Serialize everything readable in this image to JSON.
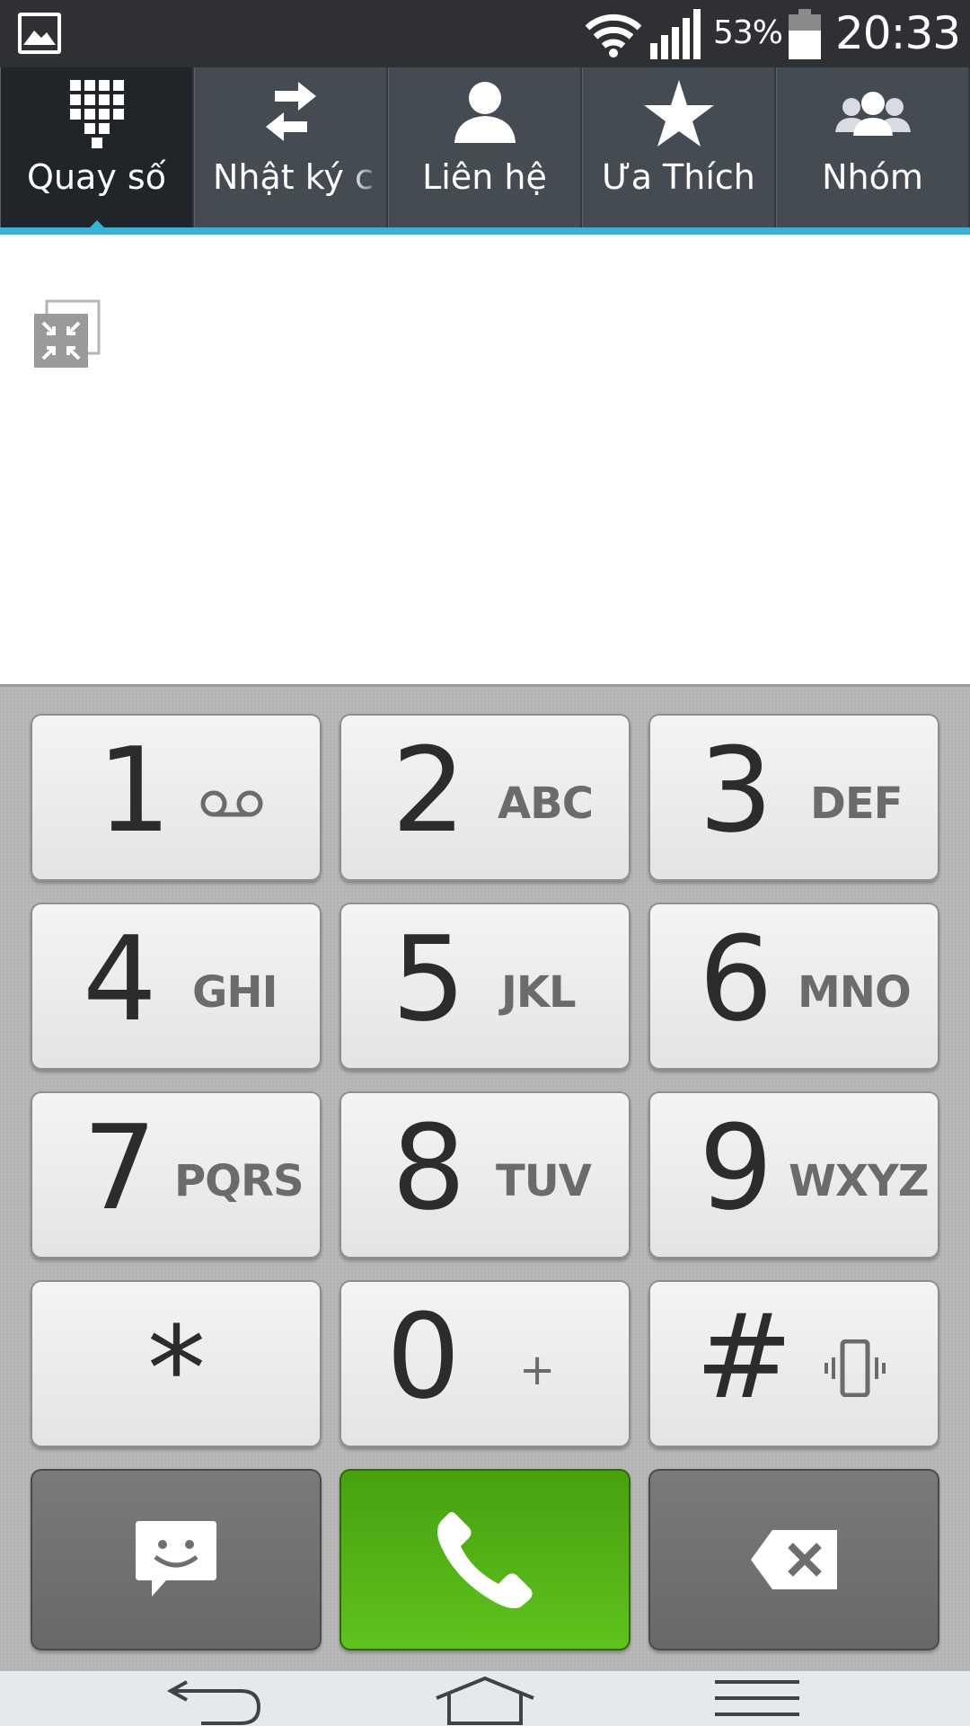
{
  "status_bar": {
    "battery_percent": "53%",
    "time": "20:33",
    "icons": [
      "gallery-notification-icon",
      "wifi-icon",
      "signal-icon",
      "battery-icon"
    ]
  },
  "tabs": [
    {
      "label": "Quay số",
      "icon": "dialpad-icon",
      "active": true
    },
    {
      "label": "Nhật ký c",
      "icon": "call-log-icon",
      "active": false
    },
    {
      "label": "Liên hệ",
      "icon": "contact-icon",
      "active": false
    },
    {
      "label": "Ưa Thích",
      "icon": "star-icon",
      "active": false
    },
    {
      "label": "Nhóm",
      "icon": "groups-icon",
      "active": false
    }
  ],
  "keypad": {
    "keys": [
      {
        "digit": "1",
        "sub": "",
        "sub_icon": "voicemail-icon"
      },
      {
        "digit": "2",
        "sub": "ABC"
      },
      {
        "digit": "3",
        "sub": "DEF"
      },
      {
        "digit": "4",
        "sub": "GHI"
      },
      {
        "digit": "5",
        "sub": "JKL"
      },
      {
        "digit": "6",
        "sub": "MNO"
      },
      {
        "digit": "7",
        "sub": "PQRS"
      },
      {
        "digit": "8",
        "sub": "TUV"
      },
      {
        "digit": "9",
        "sub": "WXYZ"
      },
      {
        "digit": "*",
        "sub": ""
      },
      {
        "digit": "0",
        "sub": "+"
      },
      {
        "digit": "#",
        "sub": "",
        "sub_icon": "vibrate-icon"
      }
    ],
    "actions": [
      "message-icon",
      "call-icon",
      "backspace-icon"
    ]
  },
  "colors": {
    "accent": "#35b4d8",
    "call_green": "#52b016",
    "tab_bar": "#454b53",
    "status_bar": "#2e3034"
  },
  "nav_bar": [
    "back-icon",
    "home-icon",
    "menu-icon"
  ]
}
